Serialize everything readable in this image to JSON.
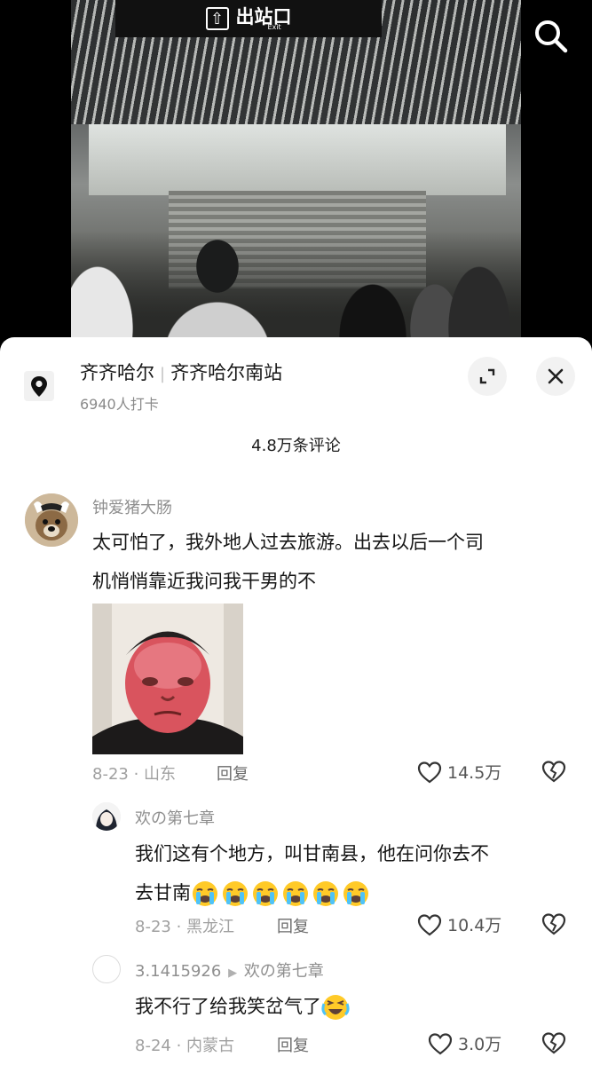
{
  "video": {
    "exit_sign": "出站口",
    "exit_sub": "Exit"
  },
  "location": {
    "city": "齐齐哈尔",
    "place": "齐齐哈尔南站",
    "checkins": "6940人打卡"
  },
  "comments_header": "4.8万条评论",
  "comments": [
    {
      "user": "钟爱猪大肠",
      "text_line1": "太可怕了，我外地人过去旅游。出去以后一个司",
      "text_line2": "机悄悄靠近我问我干男的不",
      "date_region": "8-23 · 山东",
      "reply_label": "回复",
      "likes": "14.5万"
    },
    {
      "user": "欢の第七章",
      "text_line1": "我们这有个地方，叫甘南县，他在问你去不",
      "text_line2": "去甘南",
      "date_region": "8-23 · 黑龙江",
      "reply_label": "回复",
      "likes": "10.4万"
    },
    {
      "user": "3.1415926",
      "reply_to": "欢の第七章",
      "text_line1": "我不行了给我笑岔气了",
      "date_region": "8-24 · 内蒙古",
      "reply_label": "回复",
      "likes": "3.0万"
    }
  ]
}
